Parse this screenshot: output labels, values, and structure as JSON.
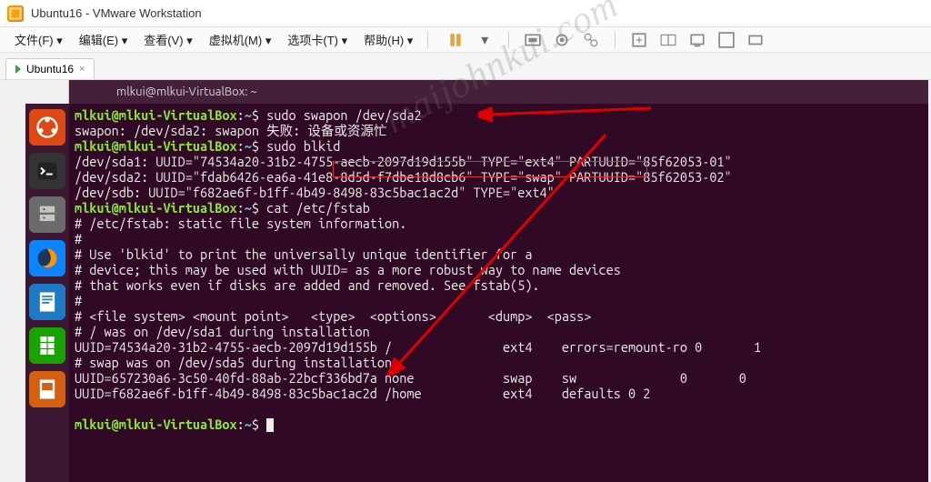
{
  "window": {
    "title": "Ubuntu16 - VMware Workstation"
  },
  "menu": {
    "file": "文件(F)",
    "edit": "编辑(E)",
    "view": "查看(V)",
    "vm": "虚拟机(M)",
    "tabs": "选项卡(T)",
    "help": "帮助(H)"
  },
  "tab": {
    "label": "Ubuntu16",
    "close": "×"
  },
  "ubuntu_bar": {
    "title": "mlkui@mlkui-VirtualBox: ~"
  },
  "prompt": {
    "user": "mlkui@mlkui-VirtualBox",
    "sep": ":",
    "path": "~",
    "dollar": "$"
  },
  "cmds": {
    "c1": " sudo swapon /dev/sda2",
    "c2": " sudo blkid",
    "c3": " cat /etc/fstab",
    "c4": " "
  },
  "out": {
    "swapon_fail": "swapon: /dev/sda2: swapon 失败: 设备或资源忙",
    "blk1": "/dev/sda1: UUID=\"74534a20-31b2-4755-aecb-2097d19d155b\" TYPE=\"ext4\" PARTUUID=\"85f62053-01\"",
    "blk2": "/dev/sda2: UUID=\"fdab6426-ea6a-41e8-8d5d-f7dbe18d8cb6\" TYPE=\"swap\" PARTUUID=\"85f62053-02\"",
    "blk3": "/dev/sdb: UUID=\"f682ae6f-b1ff-4b49-8498-83c5bac1ac2d\" TYPE=\"ext4\"",
    "f1": "# /etc/fstab: static file system information.",
    "f2": "#",
    "f3": "# Use 'blkid' to print the universally unique identifier for a",
    "f4": "# device; this may be used with UUID= as a more robust way to name devices",
    "f5": "# that works even if disks are added and removed. See fstab(5).",
    "f6": "#",
    "f7": "# <file system> <mount point>   <type>  <options>       <dump>  <pass>",
    "f8": "# / was on /dev/sda1 during installation",
    "f9": "UUID=74534a20-31b2-4755-aecb-2097d19d155b /               ext4    errors=remount-ro 0       1",
    "f10": "# swap was on /dev/sda5 during installation",
    "f11": "UUID=657230a6-3c50-40fd-88ab-22bcf336bd7a none            swap    sw              0       0",
    "f12": "UUID=f682ae6f-b1ff-4b49-8498-83c5bac1ac2d /home           ext4    defaults 0 2"
  },
  "launcher": {
    "dash": "dash-icon",
    "terminal": "terminal-icon",
    "files": "files-icon",
    "firefox": "firefox-icon",
    "writer": "writer-icon",
    "calc": "calc-icon",
    "impress": "impress-icon"
  },
  "watermark": "maijohnkui.com"
}
